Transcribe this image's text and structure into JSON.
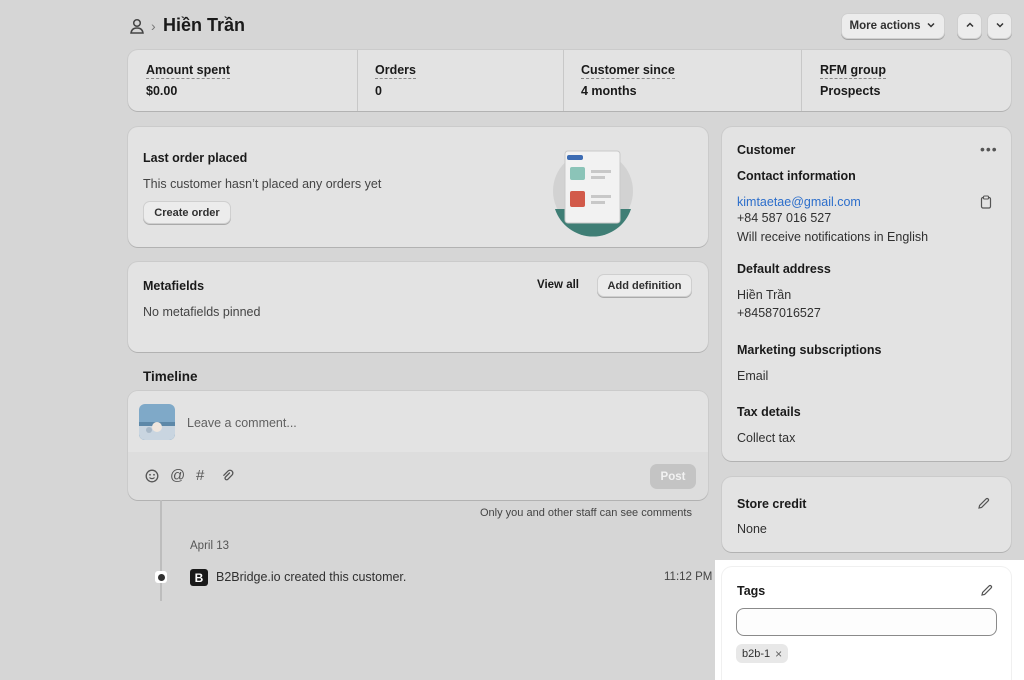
{
  "header": {
    "customer_name": "Hiền Trần",
    "more_actions_label": "More actions"
  },
  "stats": [
    {
      "label": "Amount spent",
      "value": "$0.00"
    },
    {
      "label": "Orders",
      "value": "0"
    },
    {
      "label": "Customer since",
      "value": "4 months"
    },
    {
      "label": "RFM group",
      "value": "Prospects"
    }
  ],
  "last_order": {
    "title": "Last order placed",
    "message": "This customer hasn’t placed any orders yet",
    "create_order_label": "Create order"
  },
  "metafields": {
    "title": "Metafields",
    "view_all_label": "View all",
    "add_definition_label": "Add definition",
    "empty_message": "No metafields pinned"
  },
  "timeline": {
    "title": "Timeline",
    "comment_placeholder": "Leave a comment...",
    "post_label": "Post",
    "staff_note": "Only you and other staff can see comments",
    "date": "April 13",
    "event_text": "B2Bridge.io created this customer.",
    "event_time": "11:12 PM"
  },
  "customer": {
    "title": "Customer",
    "contact_heading": "Contact information",
    "email": "kimtaetae@gmail.com",
    "phone": "+84 587 016 527",
    "notifications": "Will receive notifications in English",
    "address_heading": "Default address",
    "address_name": "Hiền Trần",
    "address_phone": "+84587016527",
    "marketing_heading": "Marketing subscriptions",
    "marketing_value": "Email",
    "tax_heading": "Tax details",
    "tax_value": "Collect tax"
  },
  "store_credit": {
    "title": "Store credit",
    "value": "None"
  },
  "tags": {
    "title": "Tags",
    "input_value": "",
    "items": [
      "b2b-1"
    ]
  },
  "colors": {
    "background_dimmed": "#d6d6d6",
    "card": "#e3e3e3",
    "link": "#2c6ecb",
    "active_card": "#ffffff"
  }
}
